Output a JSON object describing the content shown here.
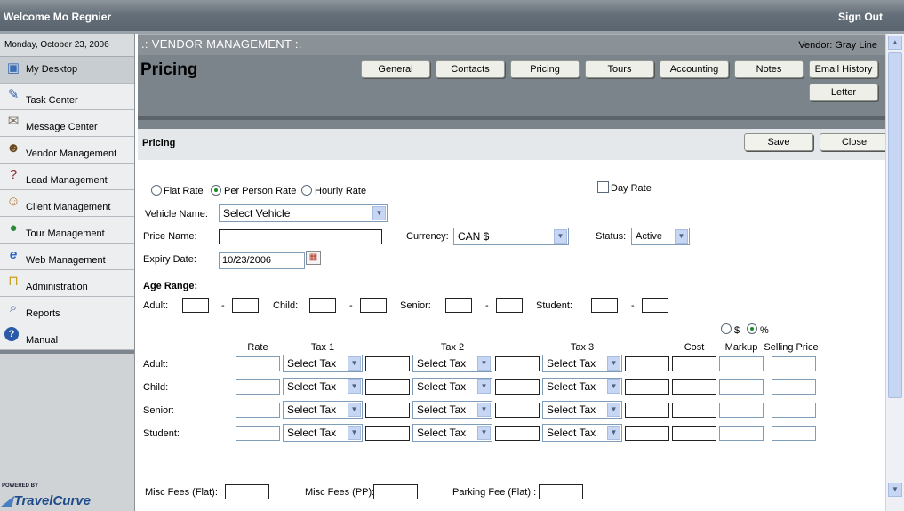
{
  "top": {
    "welcome": "Welcome Mo Regnier",
    "signout": "Sign Out"
  },
  "sidebar": {
    "date": "Monday, October 23, 2006",
    "items": [
      {
        "label": "My Desktop",
        "icon": "desktop-icon"
      },
      {
        "label": "Task Center",
        "icon": "task-icon"
      },
      {
        "label": "Message Center",
        "icon": "message-icon"
      },
      {
        "label": "Vendor Management",
        "icon": "vendor-icon"
      },
      {
        "label": "Lead Management",
        "icon": "lead-icon"
      },
      {
        "label": "Client Management",
        "icon": "client-icon"
      },
      {
        "label": "Tour Management",
        "icon": "globe-icon"
      },
      {
        "label": "Web Management",
        "icon": "ie-icon"
      },
      {
        "label": "Administration",
        "icon": "lock-icon"
      },
      {
        "label": "Reports",
        "icon": "reports-icon"
      },
      {
        "label": "Manual",
        "icon": "help-icon"
      }
    ],
    "powered": "POWERED BY",
    "brand": "TravelCurve"
  },
  "vm": {
    "title": ".: VENDOR MANAGEMENT :.",
    "vendor": "Vendor: Gray Line"
  },
  "page_title": "Pricing",
  "tabs": [
    "General",
    "Contacts",
    "Pricing",
    "Tours",
    "Accounting",
    "Notes",
    "Email History",
    "Letter"
  ],
  "section": {
    "title": "Pricing",
    "save": "Save",
    "close": "Close"
  },
  "form": {
    "rate_types": [
      "Flat Rate",
      "Per Person Rate",
      "Hourly Rate"
    ],
    "rate_selected": "Per Person Rate",
    "day_rate": "Day Rate",
    "vehicle_label": "Vehicle Name:",
    "vehicle_value": "Select Vehicle",
    "price_name_label": "Price Name:",
    "price_name_value": "",
    "currency_label": "Currency:",
    "currency_value": "CAN $",
    "status_label": "Status:",
    "status_value": "Active",
    "expiry_label": "Expiry Date:",
    "expiry_value": "10/23/2006",
    "age_range_label": "Age Range:",
    "age_groups": [
      "Adult:",
      "Child:",
      "Senior:",
      "Student:"
    ],
    "dash": "-"
  },
  "pricing": {
    "markup_options": [
      "$",
      "%"
    ],
    "markup_selected": "%",
    "headers": {
      "rate": "Rate",
      "tax1": "Tax 1",
      "tax2": "Tax 2",
      "tax3": "Tax 3",
      "cost": "Cost",
      "markup": "Markup",
      "selling": "Selling Price"
    },
    "rows": [
      "Adult:",
      "Child:",
      "Senior:",
      "Student:"
    ],
    "tax_placeholder": "Select Tax"
  },
  "fees": {
    "misc_flat": "Misc Fees (Flat):",
    "misc_pp": "Misc Fees (PP):",
    "parking": "Parking Fee (Flat) :"
  },
  "colors": {
    "accent": "#7c848b",
    "active_radio": "#1d8a2a",
    "brand": "#1e4c8a"
  }
}
